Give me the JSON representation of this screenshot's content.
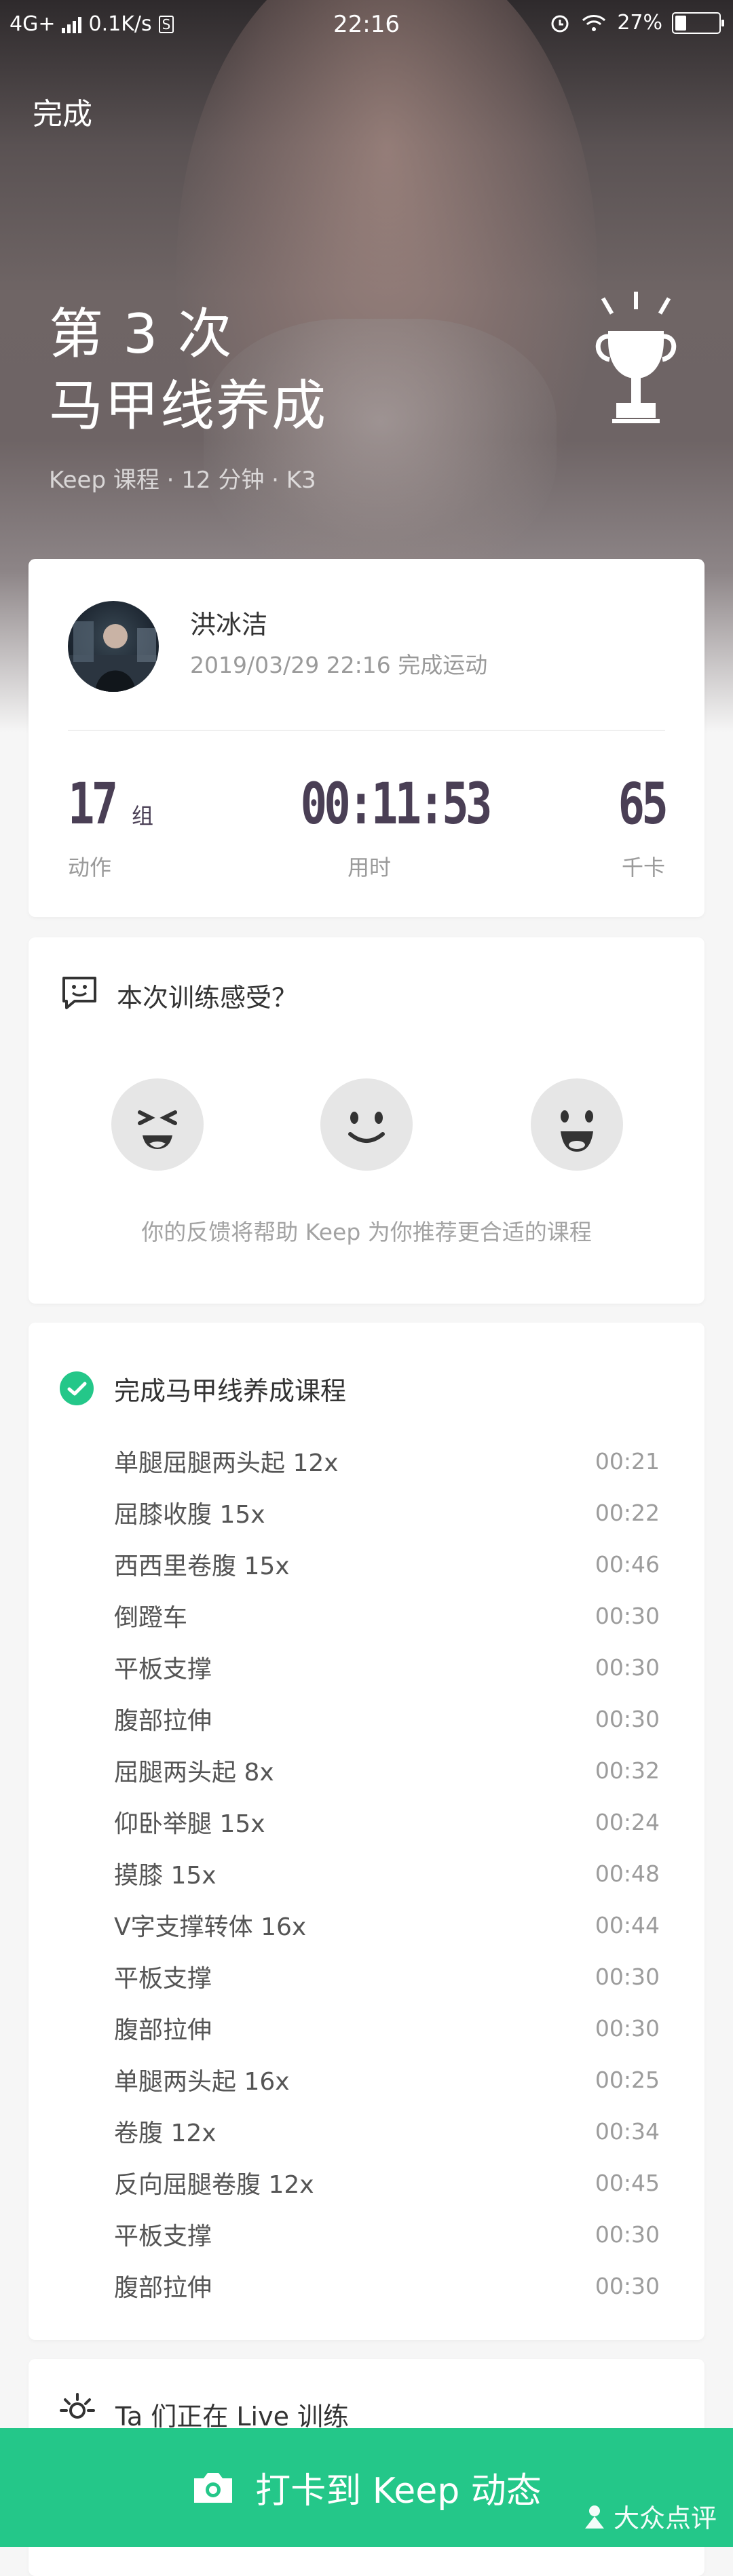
{
  "status_bar": {
    "network": "4G+",
    "speed": "0.1K/s",
    "sim_badge": "S",
    "time": "22:16",
    "battery": "27%"
  },
  "header": {
    "done_label": "完成",
    "title_line1": "第 3 次",
    "title_line2": "马甲线养成",
    "subtitle": "Keep 课程 · 12 分钟 · K3"
  },
  "summary": {
    "user_name": "洪冰洁",
    "completed_text": "2019/03/29 22:16 完成运动",
    "stats": [
      {
        "value": "17",
        "unit": "组",
        "label": "动作"
      },
      {
        "value": "00:11:53",
        "unit": "",
        "label": "用时"
      },
      {
        "value": "65",
        "unit": "",
        "label": "千卡"
      }
    ]
  },
  "feedback": {
    "title": "本次训练感受？",
    "options": [
      "hard-face-icon",
      "ok-face-icon",
      "easy-face-icon"
    ],
    "note": "你的反馈将帮助 Keep 为你推荐更合适的课程"
  },
  "course": {
    "title": "完成马甲线养成课程",
    "items": [
      {
        "name": "单腿屈腿两头起 12x",
        "time": "00:21"
      },
      {
        "name": "屈膝收腹 15x",
        "time": "00:22"
      },
      {
        "name": "西西里卷腹 15x",
        "time": "00:46"
      },
      {
        "name": "倒蹬车",
        "time": "00:30"
      },
      {
        "name": "平板支撑",
        "time": "00:30"
      },
      {
        "name": "腹部拉伸",
        "time": "00:30"
      },
      {
        "name": "屈腿两头起 8x",
        "time": "00:32"
      },
      {
        "name": "仰卧举腿 15x",
        "time": "00:24"
      },
      {
        "name": "摸膝 15x",
        "time": "00:48"
      },
      {
        "name": "V字支撑转体 16x",
        "time": "00:44"
      },
      {
        "name": "平板支撑",
        "time": "00:30"
      },
      {
        "name": "腹部拉伸",
        "time": "00:30"
      },
      {
        "name": "单腿两头起 16x",
        "time": "00:25"
      },
      {
        "name": "卷腹 12x",
        "time": "00:34"
      },
      {
        "name": "反向屈腿卷腹 12x",
        "time": "00:45"
      },
      {
        "name": "平板支撑",
        "time": "00:30"
      },
      {
        "name": "腹部拉伸",
        "time": "00:30"
      }
    ]
  },
  "live": {
    "title": "Ta 们正在 Live 训练"
  },
  "cta": {
    "label": "打卡到 Keep 动态"
  },
  "watermark": {
    "text": "大众点评"
  },
  "colors": {
    "accent": "#24c789",
    "stat_text": "#4a3f55"
  }
}
